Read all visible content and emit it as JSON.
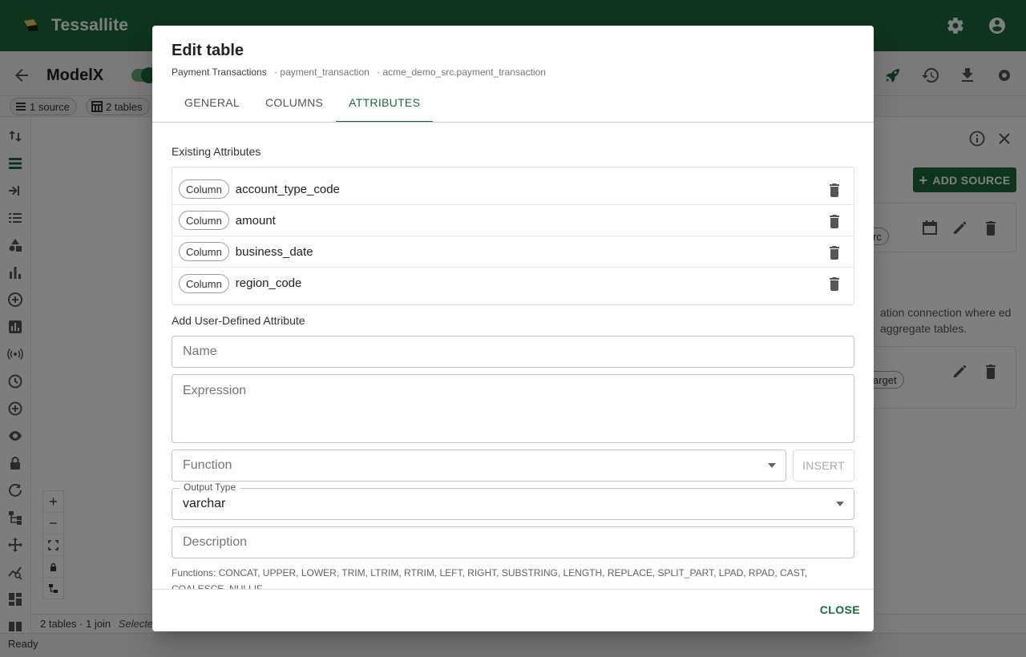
{
  "app": {
    "brand": "Tessallite"
  },
  "model": {
    "name": "ModelX"
  },
  "chips": {
    "sources": "1 source",
    "tables": "2 tables"
  },
  "canvas_footer": {
    "summary": "2 tables · 1 join",
    "selected": "Selected"
  },
  "status": "Ready",
  "side_panel": {
    "add_source": "ADD SOURCE",
    "source_chip": "rc",
    "target_chip": "arget",
    "text": "ation connection where ed aggregate tables."
  },
  "dialog": {
    "title": "Edit table",
    "subtitle": {
      "display_name": "Payment Transactions",
      "table_name": "· payment_transaction",
      "qualified_name": "· acme_demo_src.payment_transaction"
    },
    "tabs": [
      {
        "label": "GENERAL",
        "active": false
      },
      {
        "label": "COLUMNS",
        "active": false
      },
      {
        "label": "ATTRIBUTES",
        "active": true
      }
    ],
    "existing_label": "Existing Attributes",
    "attributes": [
      {
        "kind": "Column",
        "name": "account_type_code"
      },
      {
        "kind": "Column",
        "name": "amount"
      },
      {
        "kind": "Column",
        "name": "business_date"
      },
      {
        "kind": "Column",
        "name": "region_code"
      }
    ],
    "add_label": "Add User-Defined Attribute",
    "name_placeholder": "Name",
    "expression_placeholder": "Expression",
    "function_placeholder": "Function",
    "insert_label": "INSERT",
    "output_type_label": "Output Type",
    "output_type_value": "varchar",
    "description_placeholder": "Description",
    "functions_help": "Functions: CONCAT, UPPER, LOWER, TRIM, LTRIM, RTRIM, LEFT, RIGHT, SUBSTRING, LENGTH, REPLACE, SPLIT_PART, LPAD, RPAD, CAST, COALESCE, NULLIF",
    "close_label": "CLOSE"
  },
  "colors": {
    "primary": "#1b6b3a",
    "scrim": "rgba(0,0,0,0.5)"
  }
}
